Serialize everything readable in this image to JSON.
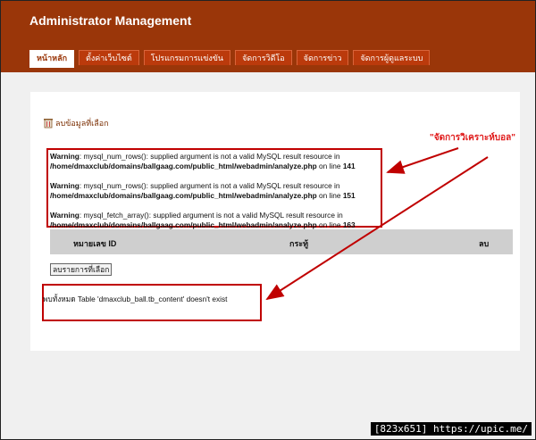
{
  "header": {
    "title": "Administrator Management"
  },
  "tabs": [
    {
      "label": "หน้าหลัก",
      "active": true
    },
    {
      "label": "ตั้งค่าเว็บไซต์"
    },
    {
      "label": "โปรแกรมการแข่งขัน"
    },
    {
      "label": "จัดการวิดีโอ"
    },
    {
      "label": "จัดการข่าว"
    },
    {
      "label": "จัดการผู้ดูแลระบบ"
    }
  ],
  "main": {
    "delete_selected_link": "ลบข้อมูลที่เลือก",
    "warnings": [
      {
        "prefix": "Warning",
        "message": ": mysql_num_rows(): supplied argument is not a valid MySQL result resource in",
        "path": "/home/dmaxclub/domains/ballgaag.com/public_html/webadmin/analyze.php",
        "online": " on line ",
        "line": "141"
      },
      {
        "prefix": "Warning",
        "message": ": mysql_num_rows(): supplied argument is not a valid MySQL result resource in",
        "path": "/home/dmaxclub/domains/ballgaag.com/public_html/webadmin/analyze.php",
        "online": " on line ",
        "line": "151"
      },
      {
        "prefix": "Warning",
        "message": ": mysql_fetch_array(): supplied argument is not a valid MySQL result resource in",
        "path": "/home/dmaxclub/domains/ballgaag.com/public_html/webadmin/analyze.php",
        "online": " on line ",
        "line": "163"
      }
    ],
    "table_headers": [
      "หมายเลข ID",
      "กระทู้",
      "ลบ"
    ],
    "delete_button": "ลบรายการที่เลือก",
    "error_text": "พบทั้งหมด Table 'dmaxclub_ball.tb_content' doesn't exist"
  },
  "annotation": {
    "text": "\"จัดการวิเคราะห์บอล\""
  },
  "footer": {
    "text": "[823x651] https://upic.me/"
  },
  "colors": {
    "header_bg": "#9a3609",
    "tab_bg": "#bb3a0c",
    "highlight": "#c00000",
    "annotation": "#e01b1b"
  }
}
